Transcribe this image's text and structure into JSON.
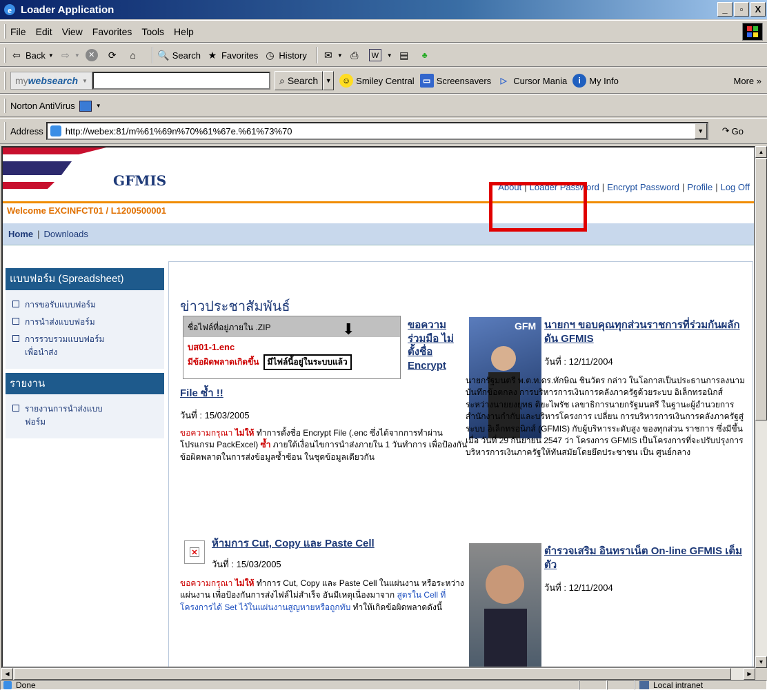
{
  "window": {
    "title": "Loader Application",
    "buttons": [
      "_",
      "▫",
      "X"
    ]
  },
  "menubar": {
    "items": [
      "File",
      "Edit",
      "View",
      "Favorites",
      "Tools",
      "Help"
    ]
  },
  "toolbar": {
    "back": "Back",
    "search": "Search",
    "favorites": "Favorites",
    "history": "History"
  },
  "websearch": {
    "logo_prefix": "my",
    "logo_main": "websearch",
    "search_label": "Search",
    "links": [
      "Smiley Central",
      "Screensavers",
      "Cursor Mania",
      "My Info"
    ],
    "more": "More"
  },
  "norton": {
    "label": "Norton AntiVirus"
  },
  "address": {
    "label": "Address",
    "url": "http://webex:81/m%61%69n%70%61%67e.%61%73%70",
    "go": "Go"
  },
  "page": {
    "brand": "GFMIS",
    "top_links": [
      "About",
      "Loader Password",
      "Encrypt Password",
      "Profile",
      "Log Off"
    ],
    "welcome": "Welcome  EXCINFCT01 / L1200500001",
    "nav": {
      "home": "Home",
      "downloads": "Downloads"
    },
    "sidebar": {
      "section1_title": "แบบฟอร์ม (Spreadsheet)",
      "section1_items": [
        "การขอรับแบบฟอร์ม",
        "การนำส่งแบบฟอร์ม",
        "การรวบรวมแบบฟอร์ม เพื่อนำส่ง"
      ],
      "section2_title": "รายงาน",
      "section2_items": [
        "รายงานการนำส่งแบบ ฟอร์ม"
      ]
    },
    "news_heading": "ข่าวประชาสัมพันธ์",
    "img1": {
      "header": "ชื่อไฟล์ที่อยู่ภายใน .ZIP",
      "filename": "บส01-1.enc",
      "error": "มีข้อผิดพลาดเกิดขึ้น",
      "ok": "มีไฟล์นี้อยู่ในระบบแล้ว"
    },
    "news1": {
      "title_a": "ขอความ ร่วมมือ ไม่ตั้งชื่อ Encrypt",
      "title_b": "File ซ้ำ !!",
      "date": "วันที่ : 15/03/2005",
      "req": "ขอความกรุณา",
      "no": "ไม่ให้",
      "t1": "ทำการตั้งชื่อ Encrypt File (.enc ซึ่งได้จากการทำผ่านโปรแกรม PackExcel)",
      "dup": "ซ้ำ",
      "t2": "ภายใต้เงื่อนไขการนำส่งภายใน 1 วันทำการ เพื่อป้องกันข้อผิดพลาดในการส่งข้อมูลซ้ำซ้อน ในชุดข้อมูลเดียวกัน"
    },
    "news2": {
      "title": "ห้ามการ Cut, Copy และ Paste Cell",
      "date": "วันที่ : 15/03/2005",
      "req": "ขอความกรุณา",
      "no": "ไม่ให้",
      "t1": "ทำการ Cut, Copy และ Paste Cell ในแผ่นงาน หรือระหว่างแผ่นงาน เพื่อป้องกันการส่งไฟล์ไม่สำเร็จ อันมีเหตุเนื่องมาจาก",
      "blue": "สูตรใน Cell ที่โครงการได้ Set ไว้ในแผ่นงานสูญหายหรือถูกทับ",
      "t2": "ทำให้เกิดข้อผิดพลาดดังนี้"
    },
    "news3": {
      "title": "นายกฯ ขอบคุณทุกส่วนราชการที่ร่วมกันผลักดัน GFMIS",
      "date": "วันที่ : 12/11/2004",
      "body": "นายกรัฐมนตรี พ.ต.ท.ดร.ทักษิณ ชินวัตร กล่าว ในโอกาสเป็นประธานการลงนามบันทึกข้อตกลง การบริหารการเงินการคลังภาครัฐด้วยระบบ อิเล็กทรอนิกส์ ระหว่างนายยงยุทธ ติยะไพรัช เลขาธิการนายกรัฐมนตรี ในฐานะผู้อำนวยการ สำนักงานกำกับและบริหารโครงการ เปลี่ยน การบริหารการเงินการคลังภาครัฐสู่ระบบ อิเล็กทรอนิกส์ (GFMIS) กับผู้บริหารระดับสูง ของทุกส่วน ราชการ ซึ่งมีขึ้นเมื่อ วันที่ 29 กันยายน 2547 ว่า โครงการ GFMIS เป็นโครงการที่จะปรับปรุงการ บริหารการเงินภาครัฐให้ทันสมัยโดยยึดประชาชน เป็น ศูนย์กลาง"
    },
    "news4": {
      "title": "ตำรวจเสริม อินทราเน็ต On-line GFMIS เต็มตัว",
      "date": "วันที่ : 12/11/2004"
    }
  },
  "status": {
    "text": "Done",
    "zone": "Local intranet"
  }
}
